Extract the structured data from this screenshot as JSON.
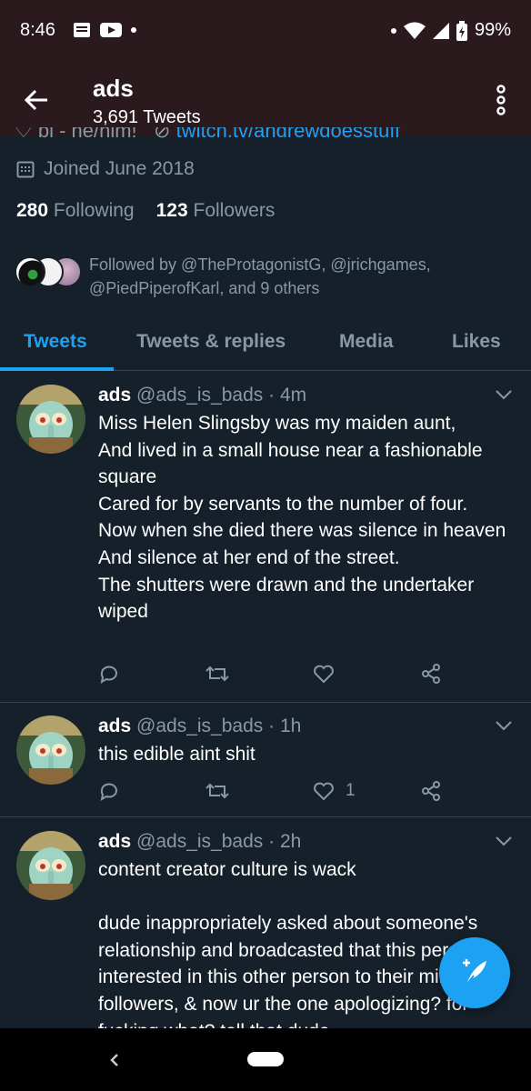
{
  "status_bar": {
    "time": "8:46",
    "battery": "99%"
  },
  "app_bar": {
    "title": "ads",
    "tweet_count": "3,691 Tweets"
  },
  "profile": {
    "bio_line_cut": "bi - he/him!",
    "website": "twitch.tv/andrewdoesstuff",
    "joined": "Joined June 2018",
    "following_count": "280",
    "following_label": "Following",
    "followers_count": "123",
    "followers_label": "Followers",
    "followed_by": "Followed by @TheProtagonistG, @jrichgames, @PiedPiperofKarl, and 9 others"
  },
  "tabs": [
    {
      "label": "Tweets",
      "active": true
    },
    {
      "label": "Tweets & replies",
      "active": false
    },
    {
      "label": "Media",
      "active": false
    },
    {
      "label": "Likes",
      "active": false
    }
  ],
  "tweets": [
    {
      "name": "ads",
      "handle": "@ads_is_bads",
      "time": "· 4m",
      "text": "Miss Helen Slingsby was my maiden aunt,\nAnd lived in a small house near a fashionable square\nCared for by servants to the number of four.\nNow when she died there was silence in heaven\nAnd silence at her end of the street.\nThe shutters were drawn and the undertaker wiped",
      "like_count": ""
    },
    {
      "name": "ads",
      "handle": "@ads_is_bads",
      "time": "· 1h",
      "text": "this edible aint shit",
      "like_count": "1"
    },
    {
      "name": "ads",
      "handle": "@ads_is_bads",
      "time": "· 2h",
      "text": "content creator culture is wack\n\ndude inappropriately asked about someone's relationship and broadcasted that this person is interested in this other person to their millions of followers, & now ur the one apologizing? for fucking what? tell that dude",
      "like_count": ""
    }
  ],
  "colors": {
    "accent": "#1da1f2",
    "background": "#15202b",
    "muted": "#8899a6",
    "header_bg": "#2a1a1d"
  },
  "icons": [
    "arrow-back-icon",
    "more-vertical-icon",
    "calendar-icon",
    "reply-icon",
    "retweet-icon",
    "like-icon",
    "share-icon",
    "compose-tweet-icon"
  ]
}
